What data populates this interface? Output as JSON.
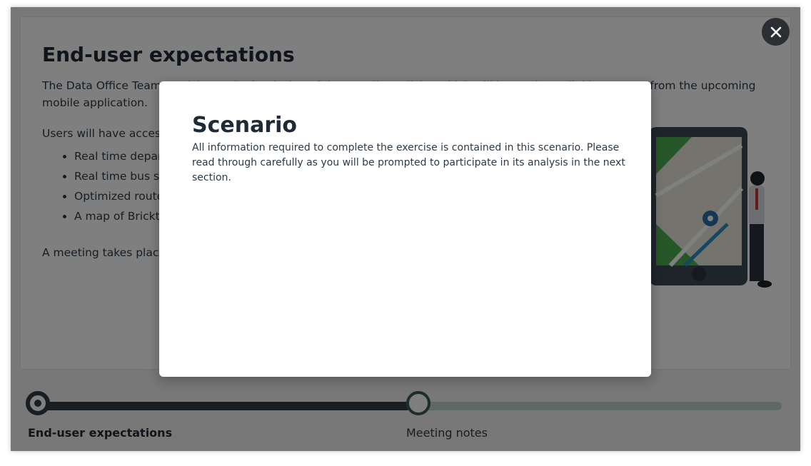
{
  "page": {
    "title": "End-user expectations",
    "intro": "The Data Office Team participates in the design of data quality policies which will be made available to users from the upcoming mobile application.",
    "access_text": "Users will have access to:",
    "features": [
      "Real time departure information",
      "Real time bus status",
      "Optimized route planning",
      "A map of Brickton"
    ],
    "meeting_text": "A meeting takes place to discuss expectations of end-users."
  },
  "progress": {
    "steps": [
      {
        "label": "End-user expectations",
        "state": "current"
      },
      {
        "label": "Meeting notes",
        "state": "upcoming"
      }
    ],
    "colors": {
      "done": "#333d47",
      "todo": "#bfd0cc"
    }
  },
  "modal": {
    "title": "Scenario",
    "body": "All information required to complete the exercise is contained in this scenario. Please read through carefully as you will be prompted to participate in its analysis in the next section."
  },
  "icons": {
    "close": "close-icon",
    "illustration": "map-phone-person-illustration"
  },
  "colors": {
    "overlay": "rgba(0,0,0,0.5)",
    "close_button": "#2b2f33",
    "map_green": "#4caf50",
    "route_blue": "#2a8fc0"
  }
}
